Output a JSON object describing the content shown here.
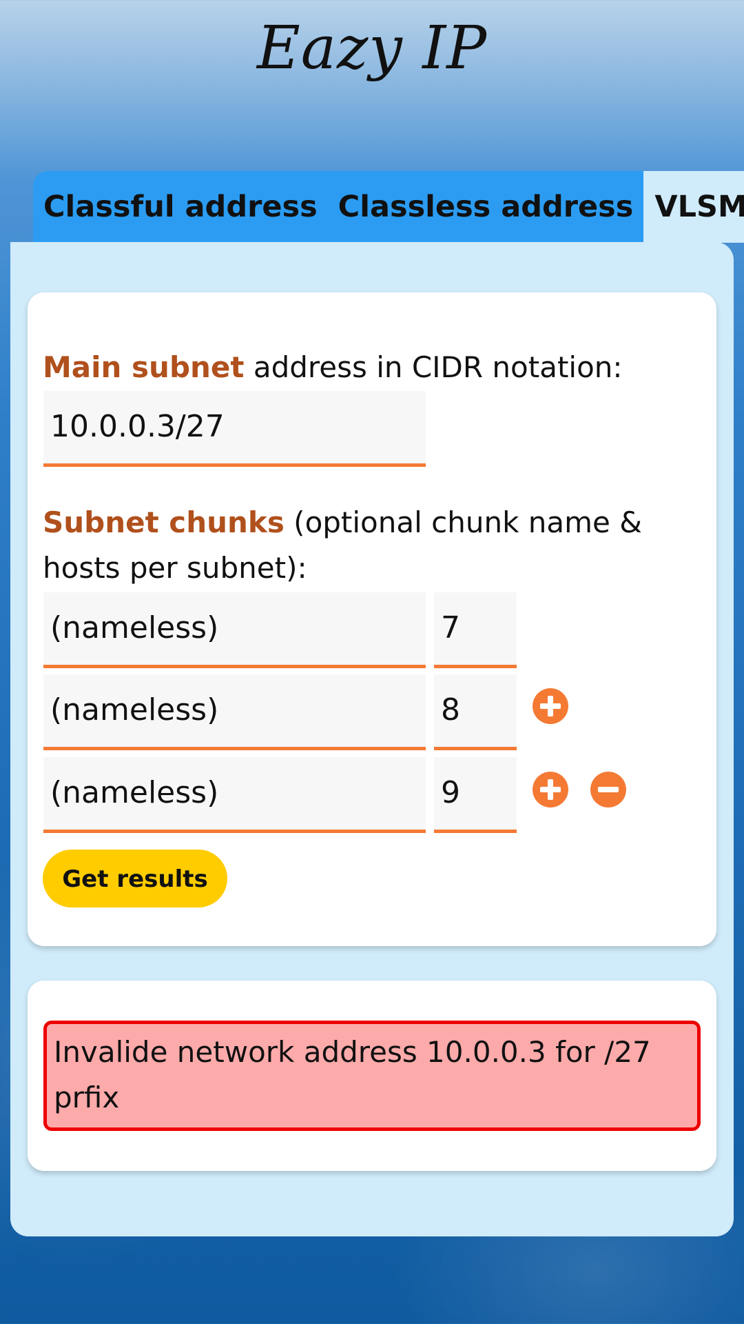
{
  "app": {
    "title": "Eazy IP"
  },
  "tabs": [
    {
      "label": "Classful address",
      "active": false
    },
    {
      "label": "Classless address",
      "active": false
    },
    {
      "label": "VLSM",
      "active": true
    }
  ],
  "form": {
    "main_subnet": {
      "label_accent": "Main subnet",
      "label_rest": " address in CIDR notation:",
      "value": "10.0.0.3/27"
    },
    "chunks": {
      "label_accent": "Subnet chunks",
      "label_rest": " (optional chunk name & hosts per subnet):",
      "rows": [
        {
          "name": "(nameless)",
          "hosts": "7"
        },
        {
          "name": "(nameless)",
          "hosts": "8"
        },
        {
          "name": "(nameless)",
          "hosts": "9"
        }
      ]
    },
    "submit_label": "Get results"
  },
  "result": {
    "error_message": "Invalide network address 10.0.0.3 for /27 prfix"
  },
  "icons": {
    "add": "plus-circle-icon",
    "remove": "minus-circle-icon"
  },
  "colors": {
    "accent_text": "#b0501c",
    "field_underline": "#f47a34",
    "icon_button": "#f47a34",
    "tab_inactive": "#2b9cf2",
    "panel": "#d0ebfa",
    "submit_button": "#ffcc00",
    "error_background": "#fdaaaa",
    "error_border": "#ee0000"
  }
}
